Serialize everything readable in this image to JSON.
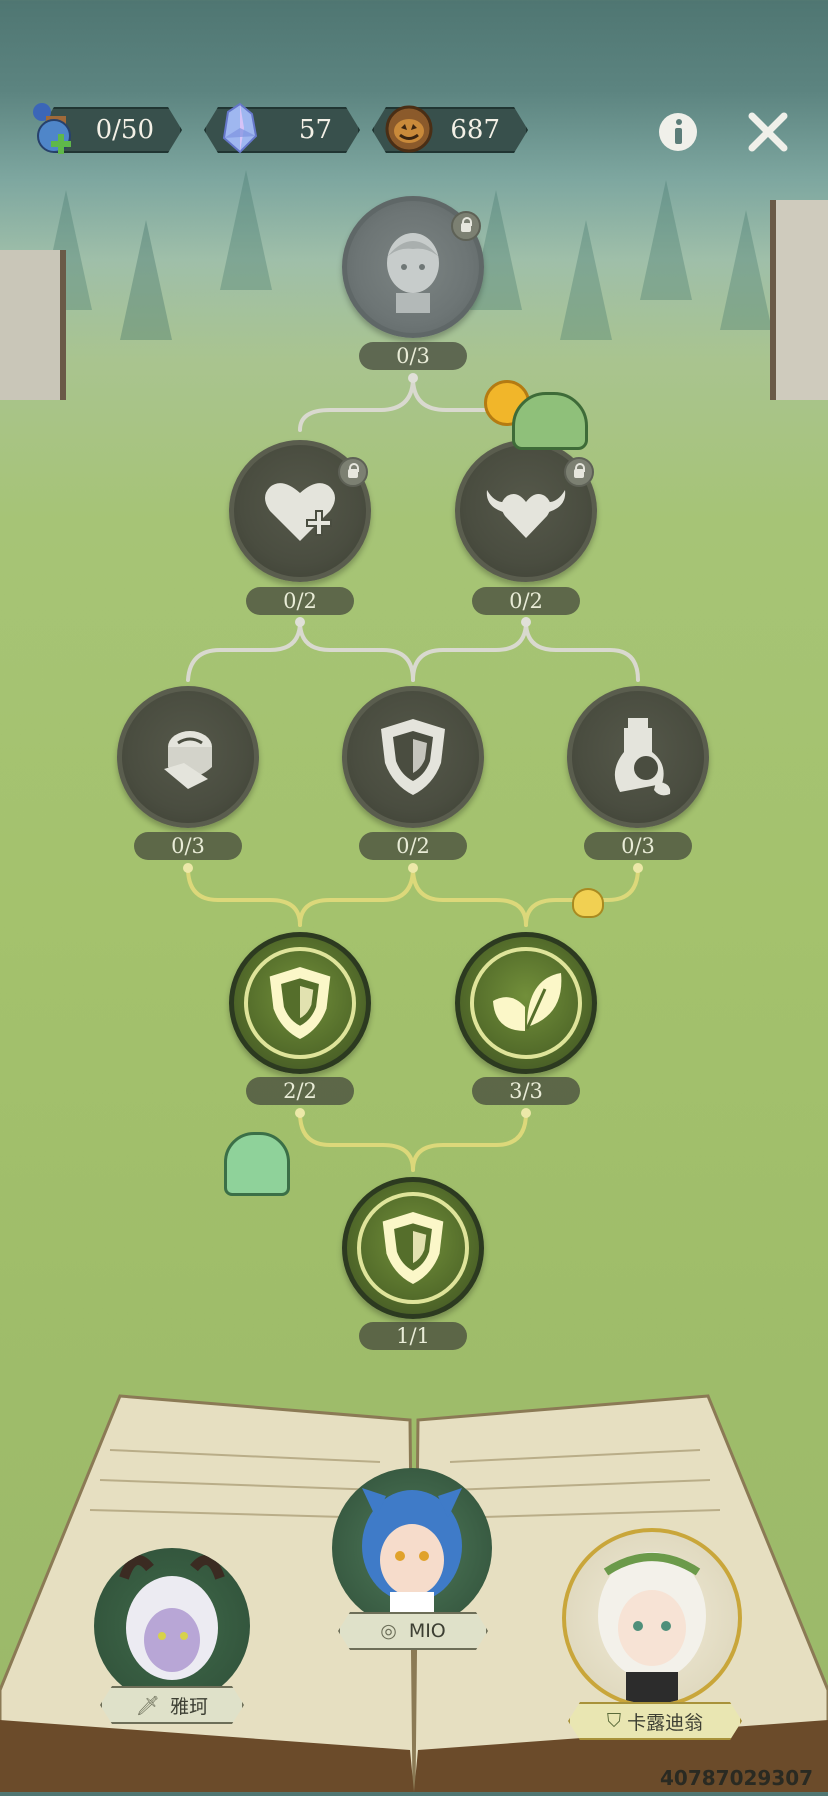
{
  "currency": {
    "energy": "0/50",
    "gems": "57",
    "coins": "687"
  },
  "icons": {
    "energy": "potion-bottle-icon",
    "gems": "crystal-icon",
    "coins": "pumpkin-coin-icon",
    "info": "info-icon",
    "close": "close-icon"
  },
  "tree": {
    "nodes": [
      {
        "id": "top-portrait",
        "count": "0/3",
        "state": "locked",
        "icon": "character-portrait-icon"
      },
      {
        "id": "heal",
        "count": "0/2",
        "state": "locked",
        "icon": "heart-plus-icon"
      },
      {
        "id": "winged-heart",
        "count": "0/2",
        "state": "locked",
        "icon": "winged-heart-icon"
      },
      {
        "id": "bandage",
        "count": "0/3",
        "state": "inactive",
        "icon": "bandage-roll-icon"
      },
      {
        "id": "shield-mid",
        "count": "0/2",
        "state": "inactive",
        "icon": "shield-icon"
      },
      {
        "id": "cleanse",
        "count": "0/3",
        "state": "inactive",
        "icon": "potion-splash-icon"
      },
      {
        "id": "shield-l4",
        "count": "2/2",
        "state": "active",
        "icon": "shield-icon"
      },
      {
        "id": "leaf",
        "count": "3/3",
        "state": "active",
        "icon": "leaf-icon"
      },
      {
        "id": "shield-root",
        "count": "1/1",
        "state": "active",
        "icon": "shield-icon"
      }
    ]
  },
  "characters": [
    {
      "name": "雅珂",
      "role": "sword-icon"
    },
    {
      "name": "MIO",
      "role": "crown-icon"
    },
    {
      "name": "卡露迪翁",
      "role": "shield-icon"
    }
  ],
  "footer_id": "40787029307",
  "colors": {
    "active_ring": "#dfe49a",
    "active_fill": "#556e2b",
    "inactive_fill": "#4a4d40",
    "line_active": "#dcd87a",
    "line_inactive": "#d9d9cf"
  }
}
